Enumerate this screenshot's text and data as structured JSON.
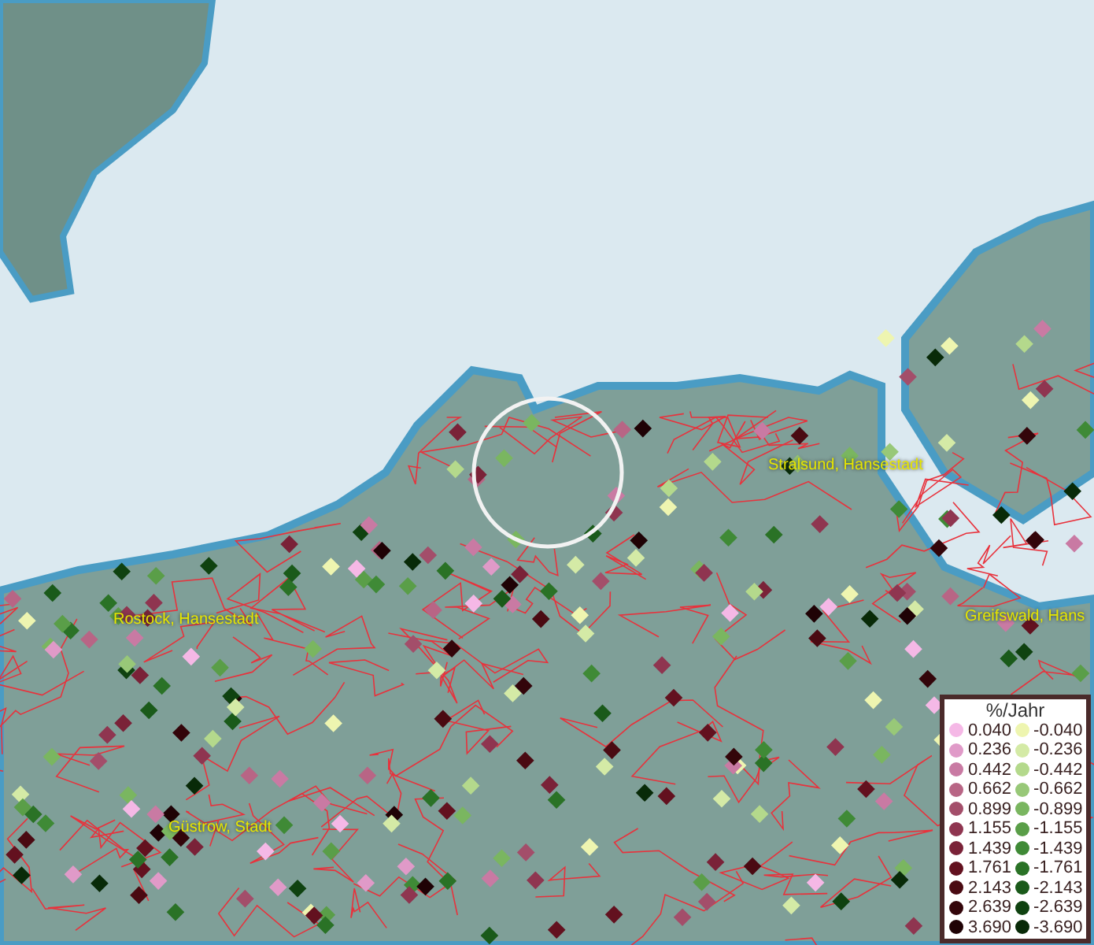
{
  "map": {
    "places": [
      {
        "name": "Stralsund, Hansestadt"
      },
      {
        "name": "Rostock, Hansestadt"
      },
      {
        "name": "Greifswald, Hans"
      },
      {
        "name": "Güstrow, Stadt"
      }
    ]
  },
  "legend": {
    "title": "%/Jahr",
    "positive": [
      {
        "label": "0.040",
        "color": "#f5b8e6"
      },
      {
        "label": "0.236",
        "color": "#e09ac8"
      },
      {
        "label": "0.442",
        "color": "#c97aa3"
      },
      {
        "label": "0.662",
        "color": "#b86585"
      },
      {
        "label": "0.899",
        "color": "#a34e6a"
      },
      {
        "label": "1.155",
        "color": "#8f3550"
      },
      {
        "label": "1.439",
        "color": "#7a2238"
      },
      {
        "label": "1.761",
        "color": "#63111f"
      },
      {
        "label": "2.143",
        "color": "#4a0a12"
      },
      {
        "label": "2.639",
        "color": "#33050a"
      },
      {
        "label": "3.690",
        "color": "#1f0205"
      }
    ],
    "negative": [
      {
        "label": "-0.040",
        "color": "#eef5b0"
      },
      {
        "label": "-0.236",
        "color": "#d4eaa6"
      },
      {
        "label": "-0.442",
        "color": "#b4d98c"
      },
      {
        "label": "-0.662",
        "color": "#98c878"
      },
      {
        "label": "-0.899",
        "color": "#7ab660"
      },
      {
        "label": "-1.155",
        "color": "#5a9e48"
      },
      {
        "label": "-1.439",
        "color": "#3f8a36"
      },
      {
        "label": "-1.761",
        "color": "#2a7226"
      },
      {
        "label": "-2.143",
        "color": "#1a5a1a"
      },
      {
        "label": "-2.639",
        "color": "#0f4210"
      },
      {
        "label": "-3.690",
        "color": "#082a08"
      }
    ]
  }
}
